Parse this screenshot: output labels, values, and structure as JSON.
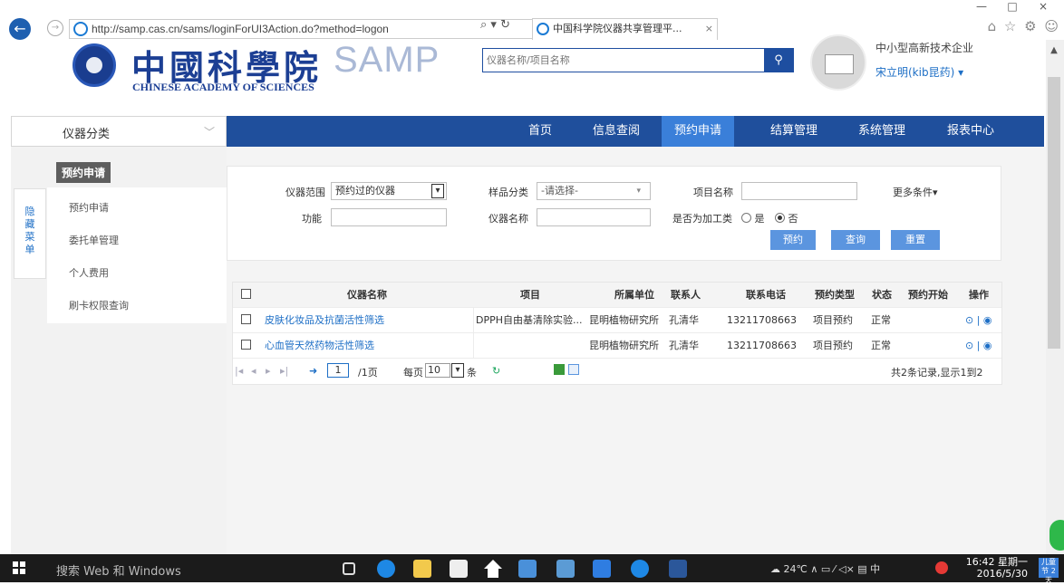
{
  "browser": {
    "url": "http://samp.cas.cn/sams/loginForUI3Action.do?method=logon",
    "addr_tools": "⌕ ▾ ↻",
    "tab_title": "中国科学院仪器共享管理平...",
    "tab_close": "×",
    "window_controls": [
      "—",
      "□",
      "×"
    ],
    "toolbar_icons": "⌂ ☆ ⚙ ☺"
  },
  "header": {
    "logo_cn": "中國科學院",
    "logo_en": "CHINESE ACADEMY OF SCIENCES",
    "logo_samp": "SAMP",
    "search_placeholder": "仪器名称/项目名称",
    "search_icon": "search-icon",
    "company": "中小型高新技术企业",
    "user": "宋立明(kib昆药) ▾"
  },
  "nav": {
    "category_label": "仪器分类",
    "category_chevron": "﹀",
    "items": [
      "首页",
      "信息查阅",
      "预约申请",
      "结算管理",
      "系统管理",
      "报表中心"
    ],
    "active_index": 2
  },
  "sidebar": {
    "hide_menu": "隐藏菜单",
    "title": "预约申请",
    "items": [
      "预约申请",
      "委托单管理",
      "个人费用",
      "刷卡权限查询"
    ]
  },
  "filter": {
    "scope_label": "仪器范围",
    "scope_value": "预约过的仪器",
    "sample_label": "样品分类",
    "sample_value": "-请选择-",
    "project_label": "项目名称",
    "project_value": "",
    "more_label": "更多条件",
    "more_chevron": "▾",
    "function_label": "功能",
    "function_value": "",
    "instrument_label": "仪器名称",
    "instrument_value": "",
    "processing_label": "是否为加工类",
    "yes_label": "是",
    "no_label": "否",
    "processing_selected": "否",
    "book_button": "预约",
    "query_button": "查询",
    "reset_button": "重置"
  },
  "table": {
    "columns": [
      "仪器名称",
      "项目",
      "所属单位",
      "联系人",
      "联系电话",
      "预约类型",
      "状态",
      "预约开始",
      "操作"
    ],
    "rows": [
      {
        "name": "皮肤化妆品及抗菌活性筛选",
        "project": "DPPH自由基清除实验...",
        "unit": "昆明植物研究所",
        "contact": "孔清华",
        "phone": "13211708663",
        "type": "项目预约",
        "status": "正常",
        "start": "",
        "ops": "⊙ | ◉"
      },
      {
        "name": "心血管天然药物活性筛选",
        "project": "",
        "unit": "昆明植物研究所",
        "contact": "孔清华",
        "phone": "13211708663",
        "type": "项目预约",
        "status": "正常",
        "start": "",
        "ops": "⊙ | ◉"
      }
    ],
    "pager": {
      "first": "|◂",
      "prev": "◂",
      "next": "▸",
      "last": "▸|",
      "go": "➜",
      "page": "1",
      "total_pages": "/1页",
      "per_page_label": "每页",
      "per_page": "10",
      "per_page_unit": "条",
      "refresh": "↻",
      "summary": "共2条记录,显示1到2"
    }
  },
  "taskbar": {
    "search": "搜索 Web 和 Windows",
    "tray": "☁ 24℃ ∧ ▭ ⁄ ◁× ▤ 中",
    "time": "16:42 星期一",
    "date": "2016/5/30",
    "notif": "儿童节 2天"
  }
}
